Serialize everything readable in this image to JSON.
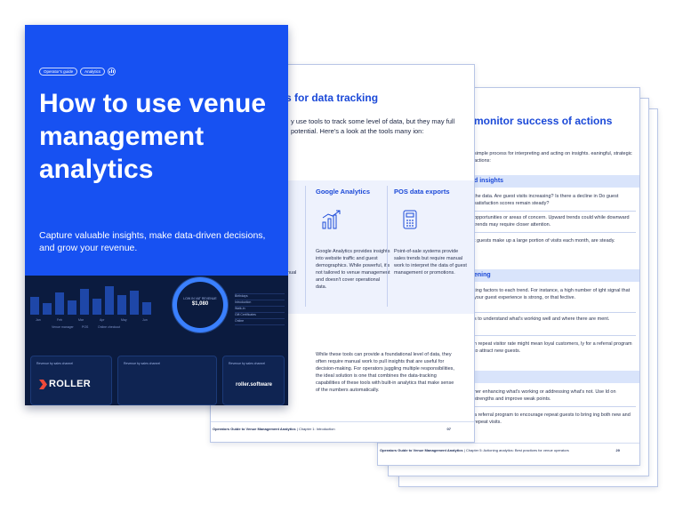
{
  "back_page": {
    "title": "monitor success of actions",
    "intro": "simple process for interpreting and acting on insights. eaningful, strategic actions:",
    "band1": "d insights",
    "band1_text_a": "the data. Are guest visits increasing? Is there a decline in Do guest satisfaction scores remain steady?",
    "band1_text_b": "opportunities or areas of concern. Upward trends could while downward trends may require closer attention.",
    "band1_text_c": "t guests make up a large portion of visits each month, are steady.",
    "band2": "ening",
    "band2_text_a": "ting factors to each trend. For instance, a high number of ight signal that your guest experience is strong, or that fective.",
    "band2_text_b": "s to understand what's working well and where there are ment.",
    "band2_text_c": "h repeat visitor rate might mean loyal customers, ly for a referral program to attract new guests.",
    "band3": "",
    "band3_text_a": "her enhancing what's working or addressing what's not. Use ld on strengths and improve weak points.",
    "band3_text_b": "a referral program to encourage repeat guests to bring ing both new and repeat visits.",
    "footer_title": "Operators Guide to Venue Management Analytics",
    "footer_chapter": "Chapter 5: Actioning analytics: Best practices for venue operators",
    "page_number": "20"
  },
  "middle_page": {
    "title": "s for data tracking",
    "intro": "y use tools to track some level of data, but they may full potential. Here's a look at the tools many ion:",
    "columns": [
      {
        "heading": "Google Analytics",
        "icon": "bar-chart-growth-icon",
        "text": "Google Analytics provides insights into website traffic and guest demographics. While powerful, it's not tailored to venue management and doesn't cover operational data."
      },
      {
        "heading": "POS data exports",
        "icon": "pos-terminal-icon",
        "text": "Point-of-sale systems provide sales trends but require manual work to interpret the data of guest management or promotions."
      }
    ],
    "left_fragment": "nual",
    "body": "While these tools can provide a foundational level of data, they often require manual work to pull insights that are useful for decision-making. For operators juggling multiple responsibilities, the ideal solution is one that combines the data-tracking capabilities of these tools with built-in analytics that make sense of the numbers automatically.",
    "footer_title": "Operators Guide to Venue Management Analytics",
    "footer_chapter": "Chapter 1: Introduction",
    "page_number": "07"
  },
  "cover": {
    "pills": [
      "Operator's guide",
      "Analytics"
    ],
    "title": "How to use venue management analytics",
    "subtitle": "Capture valuable insights, make data-driven decisions, and grow your revenue.",
    "dashboard": {
      "bar_values": [
        0.55,
        0.35,
        0.7,
        0.45,
        0.8,
        0.5,
        0.9,
        0.6,
        0.75,
        0.4
      ],
      "bar_labels": [
        "Jan",
        "Feb",
        "Mar",
        "Apr",
        "May",
        "Jun"
      ],
      "legend_items": [
        "Venue manager",
        "POS",
        "Online checkout"
      ],
      "donut_label": "LOW IN VAT REVENUE",
      "donut_value": "$1,080",
      "list_items": [
        "",
        "Birthdays",
        "Introduction",
        "Walk-in",
        "Gift Certificates",
        "Online"
      ],
      "cards": [
        "Revenue by sales channel",
        "Revenue by sales channel",
        "Revenue by sales channel"
      ]
    },
    "brand": "ROLLER",
    "website": "roller.software",
    "colors": {
      "cover_blue": "#1751f2",
      "cover_navy": "#0b1b3f",
      "accent_blue": "#1b49d8",
      "logo_red": "#f04a3a"
    }
  }
}
